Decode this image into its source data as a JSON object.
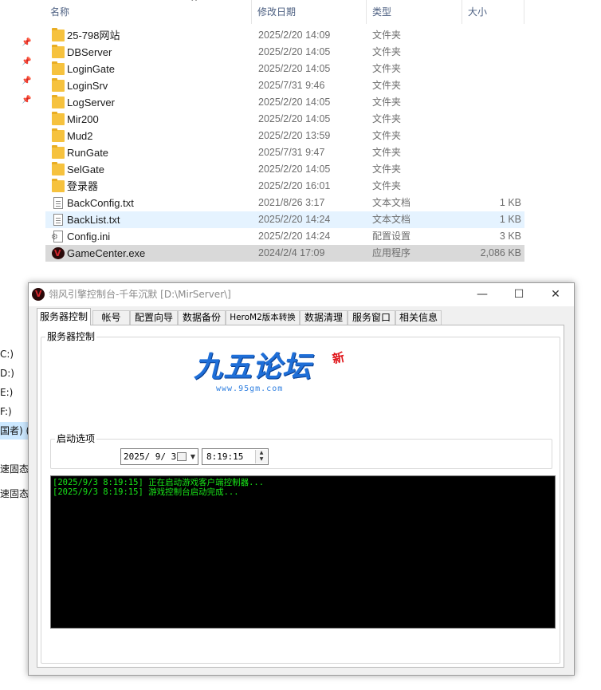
{
  "explorer": {
    "columns": {
      "name": "名称",
      "date": "修改日期",
      "type": "类型",
      "size": "大小"
    },
    "drives": [
      "C:)",
      "D:)",
      "E:)",
      "F:)",
      "国者) (G",
      "速固态",
      "速固态移"
    ],
    "files": [
      {
        "name": "25-798网站",
        "date": "2025/2/20 14:09",
        "type": "文件夹",
        "size": "",
        "icon": "folder-icon"
      },
      {
        "name": "DBServer",
        "date": "2025/2/20 14:05",
        "type": "文件夹",
        "size": "",
        "icon": "folder-icon"
      },
      {
        "name": "LoginGate",
        "date": "2025/2/20 14:05",
        "type": "文件夹",
        "size": "",
        "icon": "folder-icon"
      },
      {
        "name": "LoginSrv",
        "date": "2025/7/31 9:46",
        "type": "文件夹",
        "size": "",
        "icon": "folder-icon"
      },
      {
        "name": "LogServer",
        "date": "2025/2/20 14:05",
        "type": "文件夹",
        "size": "",
        "icon": "folder-icon"
      },
      {
        "name": "Mir200",
        "date": "2025/2/20 14:05",
        "type": "文件夹",
        "size": "",
        "icon": "folder-icon"
      },
      {
        "name": "Mud2",
        "date": "2025/2/20 13:59",
        "type": "文件夹",
        "size": "",
        "icon": "folder-icon"
      },
      {
        "name": "RunGate",
        "date": "2025/7/31 9:47",
        "type": "文件夹",
        "size": "",
        "icon": "folder-icon"
      },
      {
        "name": "SelGate",
        "date": "2025/2/20 14:05",
        "type": "文件夹",
        "size": "",
        "icon": "folder-icon"
      },
      {
        "name": "登录器",
        "date": "2025/2/20 16:01",
        "type": "文件夹",
        "size": "",
        "icon": "folder-icon"
      },
      {
        "name": "BackConfig.txt",
        "date": "2021/8/26 3:17",
        "type": "文本文档",
        "size": "1 KB",
        "icon": "text-file-icon"
      },
      {
        "name": "BackList.txt",
        "date": "2025/2/20 14:24",
        "type": "文本文档",
        "size": "1 KB",
        "icon": "text-file-icon"
      },
      {
        "name": "Config.ini",
        "date": "2025/2/20 14:24",
        "type": "配置设置",
        "size": "3 KB",
        "icon": "config-file-icon"
      },
      {
        "name": "GameCenter.exe",
        "date": "2024/2/4 17:09",
        "type": "应用程序",
        "size": "2,086 KB",
        "icon": "app-exe-icon"
      }
    ]
  },
  "window": {
    "title": "翎风引擎控制台-千年沉默 [D:\\MirServer\\]",
    "tabs": [
      "服务器控制",
      "帐号",
      "配置向导",
      "数据备份",
      "HeroM2版本转换",
      "数据清理",
      "服务窗口",
      "相关信息"
    ],
    "active_tab": "服务器控制",
    "group_server": "服务器控制",
    "group_start": "启动选项",
    "date_value": "2025/ 9/ 3",
    "time_value": "8:19:15",
    "log": [
      "[2025/9/3 8:19:15] 正在启动游戏客户端控制器...",
      "[2025/9/3 8:19:15] 游戏控制台启动完成..."
    ]
  },
  "watermark": {
    "text": "九五论坛",
    "badge": "新",
    "url": "www.95gm.com"
  },
  "colors": {
    "console_bg": "#000000",
    "console_text": "#19e619",
    "hover_row": "#e5f3ff",
    "selected_row": "#d9d9d9"
  }
}
